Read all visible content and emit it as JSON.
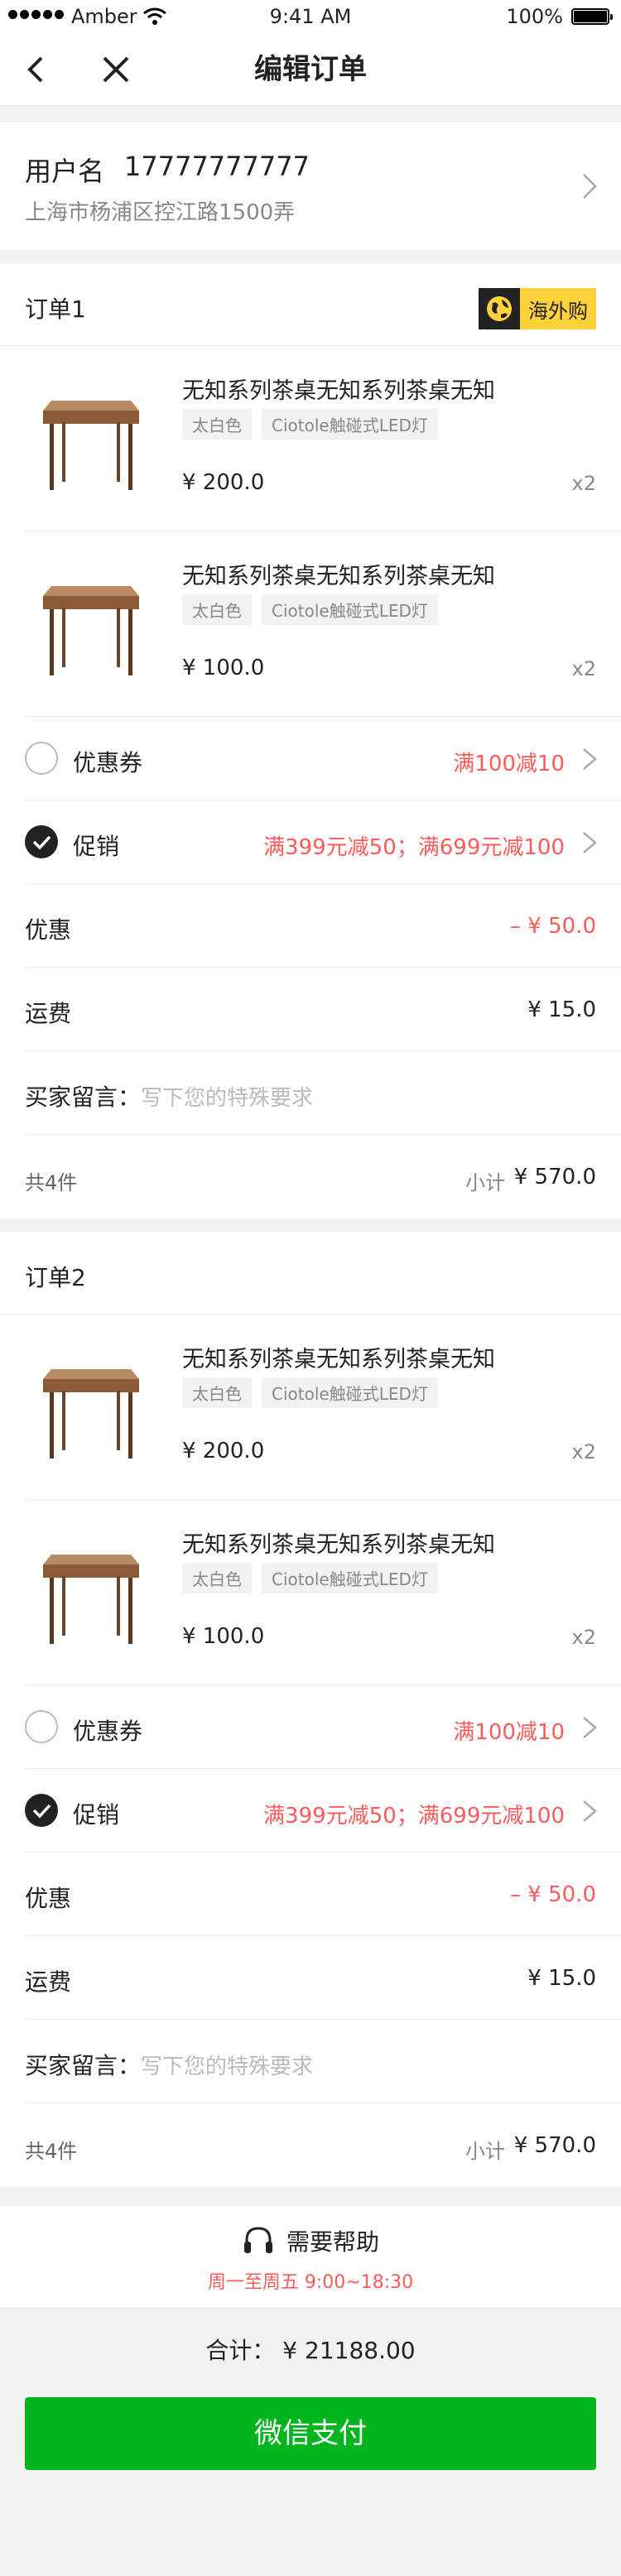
{
  "status_bar": {
    "carrier": "Amber",
    "time": "9:41 AM",
    "battery": "100%",
    "battery_level": 1.0
  },
  "nav": {
    "title": "编辑订单"
  },
  "address": {
    "name": "用户名",
    "phone": "17777777777",
    "address": "上海市杨浦区控江路1500弄"
  },
  "orders": [
    {
      "title": "订单1",
      "badge": "海外购",
      "products": [
        {
          "name": "无知系列茶桌无知系列茶桌无知",
          "tags": [
            "太白色",
            "Ciotole触碰式LED灯"
          ],
          "price": "¥ 200.0",
          "qty": "x2"
        },
        {
          "name": "无知系列茶桌无知系列茶桌无知",
          "tags": [
            "太白色",
            "Ciotole触碰式LED灯"
          ],
          "price": "¥ 100.0",
          "qty": "x2"
        }
      ],
      "coupon": {
        "label": "优惠券",
        "value": "满100减10"
      },
      "promo": {
        "label": "促销",
        "value": "满399元减50；满699元减100"
      },
      "discount": {
        "label": "优惠",
        "value": "– ¥ 50.0"
      },
      "shipping": {
        "label": "运费",
        "value": "¥ 15.0"
      },
      "message": {
        "label": "买家留言：",
        "placeholder": "写下您的特殊要求"
      },
      "summary": {
        "count": "共4件",
        "subtotal_label": "小计",
        "subtotal": "¥ 570.0"
      }
    },
    {
      "title": "订单2",
      "badge": "",
      "products": [
        {
          "name": "无知系列茶桌无知系列茶桌无知",
          "tags": [
            "太白色",
            "Ciotole触碰式LED灯"
          ],
          "price": "¥ 200.0",
          "qty": "x2"
        },
        {
          "name": "无知系列茶桌无知系列茶桌无知",
          "tags": [
            "太白色",
            "Ciotole触碰式LED灯"
          ],
          "price": "¥ 100.0",
          "qty": "x2"
        }
      ],
      "coupon": {
        "label": "优惠券",
        "value": "满100减10"
      },
      "promo": {
        "label": "促销",
        "value": "满399元减50；满699元减100"
      },
      "discount": {
        "label": "优惠",
        "value": "– ¥ 50.0"
      },
      "shipping": {
        "label": "运费",
        "value": "¥ 15.0"
      },
      "message": {
        "label": "买家留言：",
        "placeholder": "写下您的特殊要求"
      },
      "summary": {
        "count": "共4件",
        "subtotal_label": "小计",
        "subtotal": "¥ 570.0"
      }
    }
  ],
  "help": {
    "label": "需要帮助",
    "hours": "周一至周五 9:00~18:30"
  },
  "total": {
    "text": "合计： ¥ 21188.00"
  },
  "pay_button": {
    "label": "微信支付"
  },
  "colors": {
    "accent_red": "#ff5a5a",
    "pay_green": "#00b51d",
    "badge_yellow": "#ffd23b"
  },
  "icons": [
    "back-icon",
    "close-icon",
    "chevron-right-icon",
    "globe-icon",
    "radio-icon",
    "check-icon",
    "headset-icon",
    "wifi-icon"
  ]
}
